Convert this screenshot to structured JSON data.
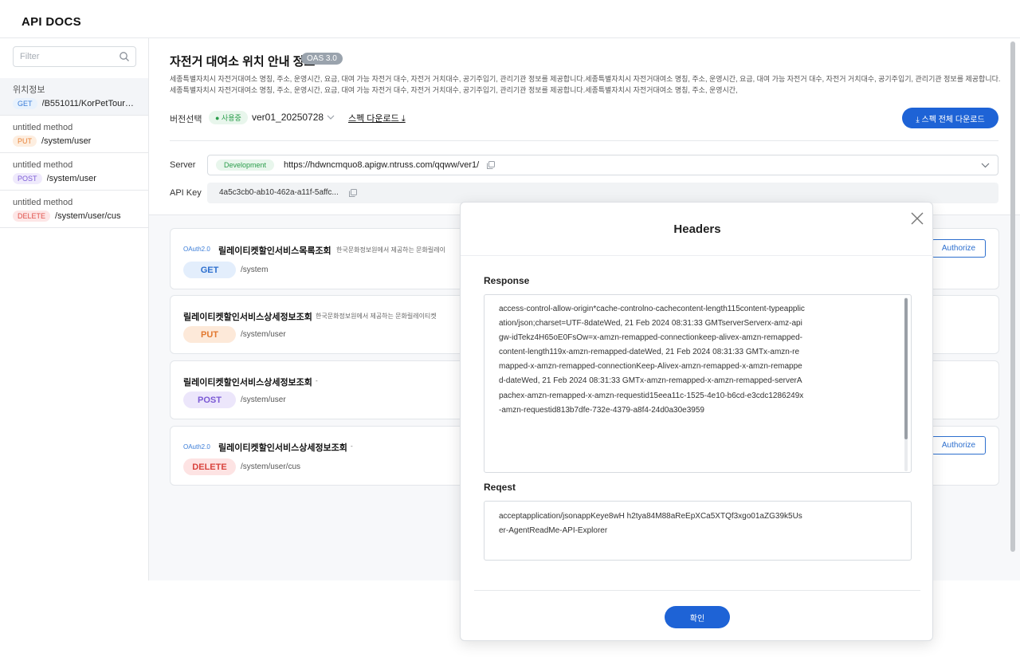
{
  "app": {
    "logo": "API DOCS"
  },
  "sidebar": {
    "filter_placeholder": "Filter",
    "items": [
      {
        "name": "위치정보",
        "method": "GET",
        "path": "/B551011/KorPetTour…"
      },
      {
        "name": "untitled method",
        "method": "PUT",
        "path": "/system/user"
      },
      {
        "name": "untitled method",
        "method": "POST",
        "path": "/system/user"
      },
      {
        "name": "untitled method",
        "method": "DELETE",
        "path": "/system/user/cus"
      }
    ]
  },
  "main": {
    "title": "자전거 대여소 위치 안내 정보",
    "oas_badge": "OAS 3.0",
    "description": "세종특별자치시 자전거대여소 명칭, 주소, 운영시간, 요금, 대여 가능 자전거 대수, 자전거 거치대수, 공기주입기, 관리기관 정보를 제공합니다.세종특별자치시 자전거대여소 명칭, 주소, 운영시간, 요금, 대여 가능 자전거 대수, 자전거 거치대수, 공기주입기, 관리기관 정보를 제공합니다.세종특별자치시 자전거대여소 명칭, 주소, 운영시간, 요금, 대여 가능 자전거 대수, 자전거 거치대수, 공기주입기, 관리기관 정보를 제공합니다.세종특별자치시 자전거대여소 명칭, 주소, 운영시간,",
    "version_label": "버전선택",
    "in_use_badge": "● 사용중",
    "version_value": "ver01_20250728",
    "spec_download": "스펙 다운로드 ⤓",
    "spec_download_all": "⤓ 스펙 전체 다운로드",
    "server_label": "Server",
    "server_badge": "Development",
    "server_url": "https://hdwncmquo8.apigw.ntruss.com/qqww/ver1/",
    "api_key_label": "API Key",
    "api_key_value": "4a5c3cb0-ab10-462a-a11f-5affc..."
  },
  "endpoints": [
    {
      "auth": "OAuth2.0",
      "title": "릴레이티켓할인서비스목록조회",
      "desc": "한국문화정보원에서 제공하는 문화릴레이",
      "method": "GET",
      "path": "/system",
      "authorize": "Authorize"
    },
    {
      "auth": "",
      "title": "릴레이티켓할인서비스상세정보조회",
      "desc": "한국문화정보원에서 제공하는 문화릴레이티켓",
      "method": "PUT",
      "path": "/system/user",
      "authorize": ""
    },
    {
      "auth": "",
      "title": "릴레이티켓할인서비스상세정보조회",
      "desc": "-",
      "method": "POST",
      "path": "/system/user",
      "authorize": ""
    },
    {
      "auth": "OAuth2.0",
      "title": "릴레이티켓할인서비스상세정보조회",
      "desc": "-",
      "method": "DELETE",
      "path": "/system/user/cus",
      "authorize": "Authorize"
    }
  ],
  "modal": {
    "title": "Headers",
    "response_label": "Response",
    "response_text": "access-control-allow-origin*cache-controlno-cachecontent-length115content-typeapplication/json;charset=UTF-8dateWed, 21 Feb 2024 08:31:33 GMTserverServerx-amz-apigw-idTekz4H65oE0FsOw=x-amzn-remapped-connectionkeep-alivex-amzn-remapped-content-length119x-amzn-remapped-dateWed, 21 Feb 2024 08:31:33 GMTx-amzn-remapped-x-amzn-remapped-connectionKeep-Alivex-amzn-remapped-x-amzn-remapped-dateWed, 21 Feb 2024 08:31:33 GMTx-amzn-remapped-x-amzn-remapped-serverApachex-amzn-remapped-x-amzn-requestid15eea11c-1525-4e10-b6cd-e3cdc1286249x-amzn-requestid813b7dfe-732e-4379-a8f4-24d0a30e3959",
    "request_label": "Reqest",
    "request_text": "acceptapplication/jsonappKeye8wH h2tya84M88aReEpXCa5XTQf3xgo01aZG39k5User-AgentReadMe-API-Explorer",
    "confirm": "확인"
  },
  "colors": {
    "primary": "#1e63d6",
    "get": "#2d6fce",
    "put": "#e2782f",
    "post": "#7a58d4",
    "delete": "#d9443e",
    "success": "#2a9d4b"
  }
}
